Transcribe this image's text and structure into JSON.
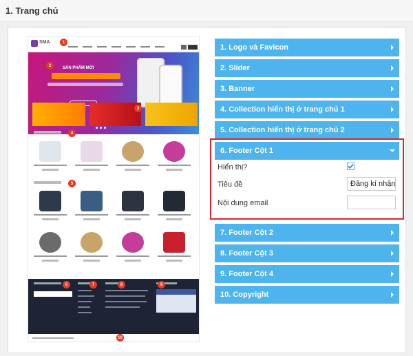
{
  "header": {
    "title": "1. Trang chủ"
  },
  "preview": {
    "logo_text": "SMA",
    "badges": [
      "1",
      "2",
      "3",
      "4",
      "5",
      "6",
      "7",
      "8",
      "9",
      "10"
    ],
    "slider_headline": "SẢN PHẨM MỚI"
  },
  "accordion": [
    {
      "label": "1. Logo và Favicon",
      "expanded": false
    },
    {
      "label": "2. Slider",
      "expanded": false
    },
    {
      "label": "3. Banner",
      "expanded": false
    },
    {
      "label": "4. Collection hiển thị ở trang chủ 1",
      "expanded": false
    },
    {
      "label": "5. Collection hiển thị ở trang chủ 2",
      "expanded": false
    },
    {
      "label": "6. Footer Cột 1",
      "expanded": true
    },
    {
      "label": "7. Footer Cột 2",
      "expanded": false
    },
    {
      "label": "8. Footer Cột 3",
      "expanded": false
    },
    {
      "label": "9. Footer Cột 4",
      "expanded": false
    },
    {
      "label": "10. Copyright",
      "expanded": false
    }
  ],
  "footer_col1_form": {
    "show_label": "Hiển thị?",
    "show_checked": true,
    "title_label": "Tiêu đề",
    "title_value": "Đăng kí nhận tin",
    "email_label": "Nội dung email",
    "email_value": ""
  },
  "colors": {
    "accordion_bg": "#4db4ed",
    "highlight_border": "#d9242a",
    "badge": "#e53925"
  }
}
